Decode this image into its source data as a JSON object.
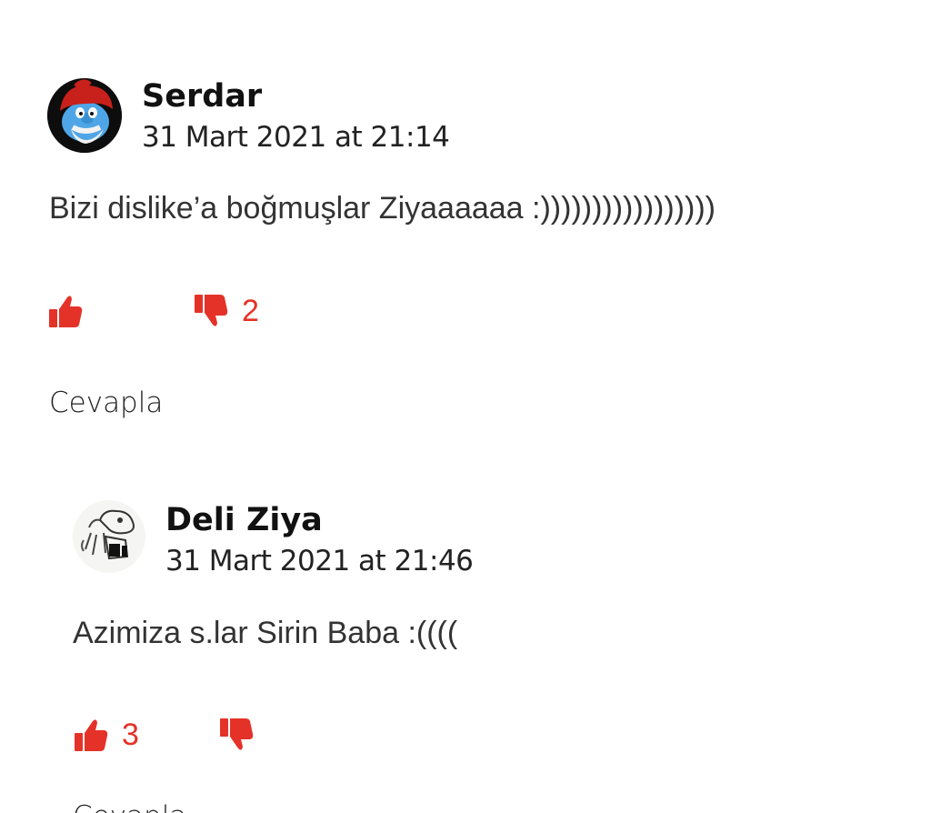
{
  "comments": [
    {
      "author": "Serdar",
      "date": "31 Mart 2021 at 21:14",
      "text": "Bizi dislike’a boğmuşlar Ziyaaaaaa :)))))))))))))))))",
      "likes": "",
      "dislikes": "2",
      "reply_label": "Cevapla",
      "avatar_icon": "papa-smurf-avatar"
    },
    {
      "author": "Deli Ziya",
      "date": "31 Mart 2021 at 21:46",
      "text": "Azimiza s.lar Sirin Baba :((((",
      "likes": "3",
      "dislikes": "",
      "reply_label": "Cevapla",
      "avatar_icon": "sketch-character-avatar"
    }
  ],
  "colors": {
    "accent": "#e53228",
    "text": "#333333"
  }
}
